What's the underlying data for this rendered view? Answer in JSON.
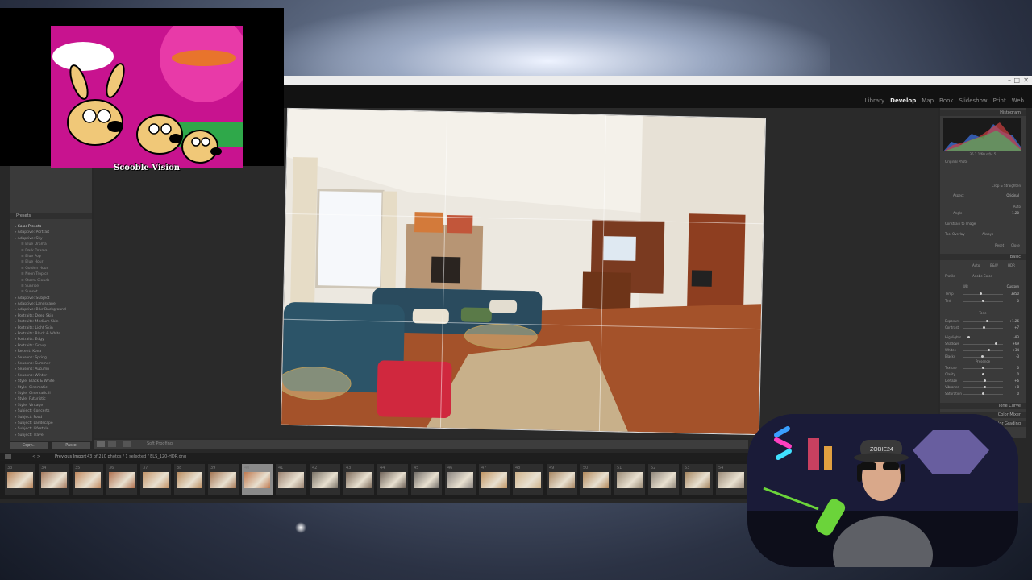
{
  "window": {
    "modules": [
      "Library",
      "Develop",
      "Map",
      "Book",
      "Slideshow",
      "Print",
      "Web"
    ],
    "active_module": "Develop",
    "window_controls": [
      "–",
      "□",
      "✕"
    ]
  },
  "left_panel": {
    "presets_header": "Presets",
    "presets": [
      {
        "label": "Color Presets",
        "level": 0
      },
      {
        "label": "Adaptive: Portrait",
        "level": 0
      },
      {
        "label": "Adaptive: Sky",
        "level": 0
      },
      {
        "label": "Blue Drama",
        "level": 1
      },
      {
        "label": "Dark Drama",
        "level": 1
      },
      {
        "label": "Blue Pop",
        "level": 1
      },
      {
        "label": "Blue Hour",
        "level": 1
      },
      {
        "label": "Golden Hour",
        "level": 1
      },
      {
        "label": "Neon Tropics",
        "level": 1
      },
      {
        "label": "Storm Clouds",
        "level": 1
      },
      {
        "label": "Sunrise",
        "level": 1
      },
      {
        "label": "Sunset",
        "level": 1
      },
      {
        "label": "Adaptive: Subject",
        "level": 0
      },
      {
        "label": "Adaptive: Landscape",
        "level": 0
      },
      {
        "label": "Adaptive: Blur Background",
        "level": 0
      },
      {
        "label": "Portraits: Deep Skin",
        "level": 0
      },
      {
        "label": "Portraits: Medium Skin",
        "level": 0
      },
      {
        "label": "Portraits: Light Skin",
        "level": 0
      },
      {
        "label": "Portraits: Black & White",
        "level": 0
      },
      {
        "label": "Portraits: Edgy",
        "level": 0
      },
      {
        "label": "Portraits: Group",
        "level": 0
      },
      {
        "label": "Recent: Kona",
        "level": 0
      },
      {
        "label": "Seasons: Spring",
        "level": 0
      },
      {
        "label": "Seasons: Summer",
        "level": 0
      },
      {
        "label": "Seasons: Autumn",
        "level": 0
      },
      {
        "label": "Seasons: Winter",
        "level": 0
      },
      {
        "label": "Style: Black & White",
        "level": 0
      },
      {
        "label": "Style: Cinematic",
        "level": 0
      },
      {
        "label": "Style: Cinematic II",
        "level": 0
      },
      {
        "label": "Style: Futuristic",
        "level": 0
      },
      {
        "label": "Style: Vintage",
        "level": 0
      },
      {
        "label": "Subject: Concerts",
        "level": 0
      },
      {
        "label": "Subject: Food",
        "level": 0
      },
      {
        "label": "Subject: Landscape",
        "level": 0
      },
      {
        "label": "Subject: Lifestyle",
        "level": 0
      },
      {
        "label": "Subject: Travel",
        "level": 0
      }
    ],
    "copy_button": "Copy...",
    "paste_button": "Paste"
  },
  "toolbar": {
    "soft_proofing": "Soft Proofing"
  },
  "right_panel": {
    "histogram_label": "Histogram",
    "histogram_readout": "35.2   1/60 s   f/4.5",
    "original_photo": "Original Photo",
    "crop_label": "Crop & Straighten",
    "aspect_label": "Aspect",
    "aspect_value": "Original",
    "angle_label": "Angle",
    "angle_value": "1.20",
    "auto_label": "Auto",
    "constrain_label": "Constrain to Image",
    "tool_overlay_label": "Tool Overlay",
    "tool_overlay_value": "Always",
    "reset_button": "Reset",
    "close_button": "Close",
    "basic_label": "Basic",
    "treatment_tabs": [
      "Auto",
      "B&W",
      "HDR"
    ],
    "profile_label": "Profile",
    "profile_value": "Adobe Color",
    "wb_label": "WB",
    "wb_value": "Custom",
    "sliders": [
      {
        "label": "Temp",
        "value": "3850",
        "pos": 0.45
      },
      {
        "label": "Tint",
        "value": "0",
        "pos": 0.5
      },
      {
        "label": "Exposure",
        "value": "+1.26",
        "pos": 0.6
      },
      {
        "label": "Contrast",
        "value": "+7",
        "pos": 0.53
      },
      {
        "label": "Highlights",
        "value": "-83",
        "pos": 0.15
      },
      {
        "label": "Shadows",
        "value": "+69",
        "pos": 0.82
      },
      {
        "label": "Whites",
        "value": "+34",
        "pos": 0.65
      },
      {
        "label": "Blacks",
        "value": "-3",
        "pos": 0.48
      },
      {
        "label": "Texture",
        "value": "0",
        "pos": 0.5
      },
      {
        "label": "Clarity",
        "value": "0",
        "pos": 0.5
      },
      {
        "label": "Dehaze",
        "value": "+6",
        "pos": 0.55
      },
      {
        "label": "Vibrance",
        "value": "+8",
        "pos": 0.55
      },
      {
        "label": "Saturation",
        "value": "0",
        "pos": 0.5
      }
    ],
    "presence_label": "Presence",
    "tone_label": "Tone",
    "tone_curve": "Tone Curve",
    "color_mixer": "Color Mixer",
    "color_grading": "Color Grading"
  },
  "filmstrip": {
    "source": "Previous Import",
    "selection": "43 of 210 photos / 1 selected / ELS_120-HDR.dng",
    "photos": [
      {
        "num": "33",
        "color": "#b8845a"
      },
      {
        "num": "34",
        "color": "#a67a5e"
      },
      {
        "num": "35",
        "color": "#c28a60"
      },
      {
        "num": "36",
        "color": "#b0704e"
      },
      {
        "num": "37",
        "color": "#c49468"
      },
      {
        "num": "38",
        "color": "#b98a5c"
      },
      {
        "num": "39",
        "color": "#a47654"
      },
      {
        "num": "40",
        "color": "#c07a50"
      },
      {
        "num": "41",
        "color": "#9a8270"
      },
      {
        "num": "42",
        "color": "#7a7266"
      },
      {
        "num": "43",
        "color": "#7c6a5a"
      },
      {
        "num": "44",
        "color": "#6e6258"
      },
      {
        "num": "45",
        "color": "#706b66"
      },
      {
        "num": "46",
        "color": "#8a8480"
      },
      {
        "num": "47",
        "color": "#c29664"
      },
      {
        "num": "48",
        "color": "#d0b48c"
      },
      {
        "num": "49",
        "color": "#a88662"
      },
      {
        "num": "50",
        "color": "#b48a5c"
      },
      {
        "num": "51",
        "color": "#9a8a76"
      },
      {
        "num": "52",
        "color": "#8e8478"
      },
      {
        "num": "53",
        "color": "#a4845e"
      },
      {
        "num": "54",
        "color": "#9c8c7a"
      }
    ],
    "selected_index": 7
  },
  "overlay_video": {
    "caption": "Scooble Vision"
  },
  "webcam": {
    "hat_text": "ZOBIE24"
  }
}
